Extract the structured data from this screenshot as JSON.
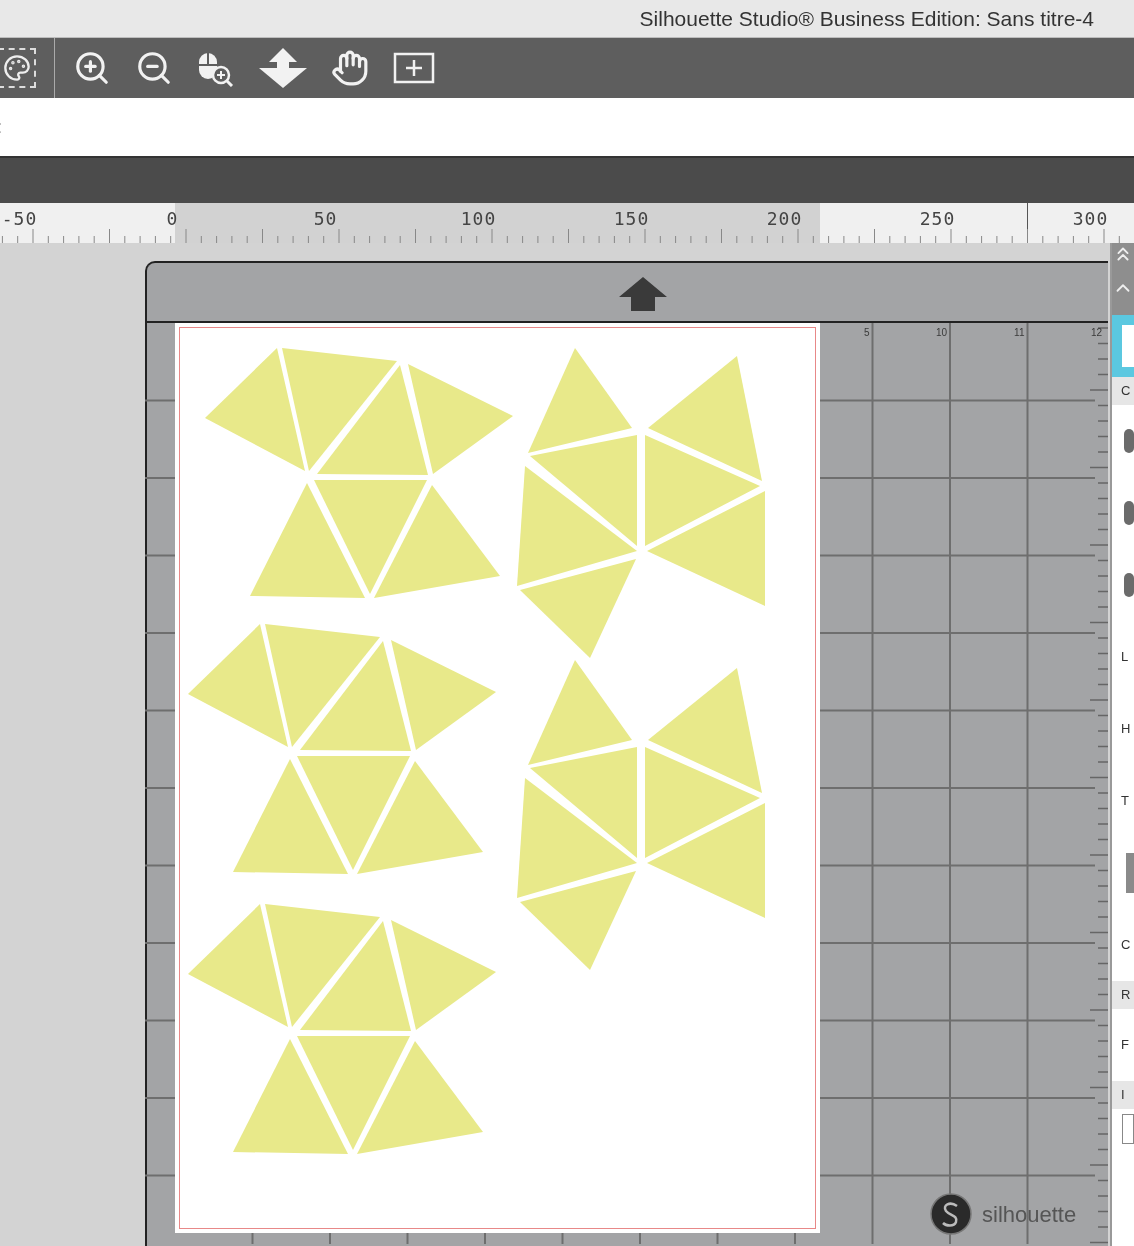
{
  "window": {
    "title": "Silhouette Studio® Business Edition: Sans titre-4"
  },
  "options_bar": {
    "text": ":"
  },
  "ruler": {
    "labels": [
      "-50",
      "0",
      "50",
      "100",
      "150",
      "200",
      "250",
      "300"
    ]
  },
  "mat": {
    "grid_labels": [
      "5",
      "10",
      "11",
      "12"
    ],
    "brand": "silhouette"
  },
  "right_panel": {
    "items": [
      {
        "kind": "header",
        "text": "C"
      },
      {
        "kind": "icon"
      },
      {
        "kind": "icon"
      },
      {
        "kind": "icon"
      },
      {
        "kind": "label",
        "text": "L"
      },
      {
        "kind": "label",
        "text": "H"
      },
      {
        "kind": "label",
        "text": "T"
      },
      {
        "kind": "swatch"
      },
      {
        "kind": "label",
        "text": "C"
      },
      {
        "kind": "header",
        "text": "R"
      },
      {
        "kind": "label",
        "text": "F"
      },
      {
        "kind": "header",
        "text": "I"
      },
      {
        "kind": "field"
      }
    ]
  }
}
